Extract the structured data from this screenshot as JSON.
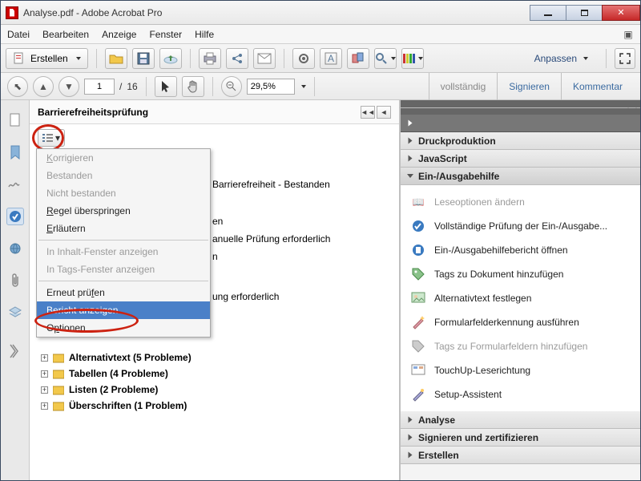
{
  "window": {
    "title": "Analyse.pdf - Adobe Acrobat Pro"
  },
  "menubar": {
    "file": "Datei",
    "edit": "Bearbeiten",
    "view": "Anzeige",
    "window": "Fenster",
    "help": "Hilfe"
  },
  "toolbar1": {
    "create": "Erstellen",
    "customize": "Anpassen"
  },
  "toolbar2": {
    "page": "1",
    "pages": "16",
    "zoom": "29,5%",
    "tab0": "vollständig",
    "tab1": "Signieren",
    "tab2": "Kommentar"
  },
  "accpanel": {
    "title": "Barrierefreiheitsprüfung",
    "frag1": "Barrierefreiheit - Bestanden",
    "frag2": "en",
    "frag3": "anuelle Prüfung erforderlich",
    "frag4": "n",
    "frag5": "ung erforderlich",
    "items": [
      {
        "label": "Alternativtext (5 Probleme)"
      },
      {
        "label": "Tabellen (4 Probleme)"
      },
      {
        "label": "Listen (2 Probleme)"
      },
      {
        "label": "Überschriften (1 Problem)"
      }
    ]
  },
  "ctxmenu": {
    "korrigieren": "Korrigieren",
    "bestanden": "Bestanden",
    "nicht_bestanden": "Nicht bestanden",
    "regel_ueberspringen": "Regel überspringen",
    "erlaeutern": "Erläutern",
    "in_inhalt": "In Inhalt-Fenster anzeigen",
    "in_tags": "In Tags-Fenster anzeigen",
    "erneut_pruefen": "Erneut prüfen",
    "bericht_anzeigen": "Bericht anzeigen",
    "optionen": "Optionen"
  },
  "rpanel": {
    "druck": "Druckproduktion",
    "javascript": "JavaScript",
    "ein_aus": "Ein-/Ausgabehilfe",
    "tools": [
      {
        "label": "Leseoptionen ändern",
        "disabled": true
      },
      {
        "label": "Vollständige Prüfung der Ein-/Ausgabe...",
        "disabled": false
      },
      {
        "label": "Ein-/Ausgabehilfebericht öffnen",
        "disabled": false
      },
      {
        "label": "Tags zu Dokument hinzufügen",
        "disabled": false
      },
      {
        "label": "Alternativtext festlegen",
        "disabled": false
      },
      {
        "label": "Formularfelderkennung ausführen",
        "disabled": false
      },
      {
        "label": "Tags zu Formularfeldern hinzufügen",
        "disabled": true
      },
      {
        "label": "TouchUp-Leserichtung",
        "disabled": false
      },
      {
        "label": "Setup-Assistent",
        "disabled": false
      }
    ],
    "analyse": "Analyse",
    "signzert": "Signieren und zertifizieren",
    "erstellen": "Erstellen"
  }
}
